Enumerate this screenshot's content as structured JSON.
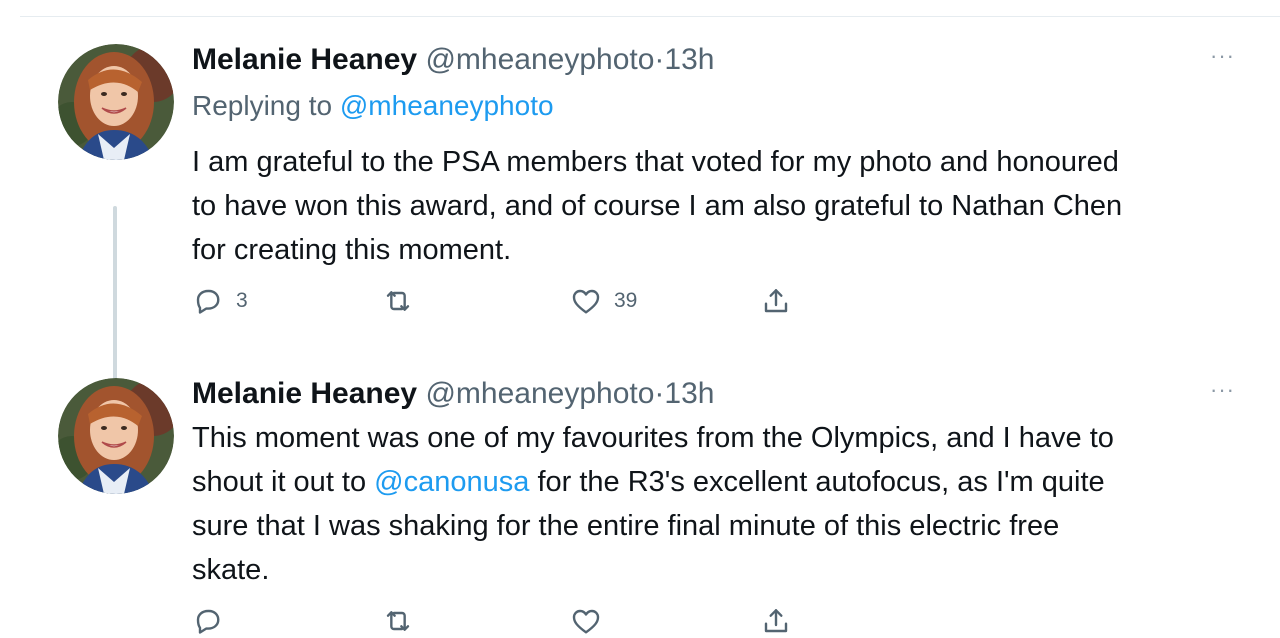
{
  "tweets": [
    {
      "author": "Melanie Heaney",
      "handle": "@mheaneyphoto",
      "separator": "·",
      "time": "13h",
      "replying_prefix": "Replying to ",
      "replying_to": "@mheaneyphoto",
      "more_label": "···",
      "text_lines": [
        "I am grateful to the PSA members that voted for my photo and honoured",
        "to have won this award, and of course I am also grateful to Nathan Chen",
        "for creating this moment."
      ],
      "reply_count": "3",
      "retweet_count": "",
      "like_count": "39"
    },
    {
      "author": "Melanie Heaney",
      "handle": "@mheaneyphoto",
      "separator": "·",
      "time": "13h",
      "more_label": "···",
      "text_line1": "This moment was one of my favourites from the Olympics, and I have to",
      "text_line2_before": "shout it out to ",
      "text_line2_mention": "@canonusa",
      "text_line2_after": " for the R3's excellent autofocus, as I'm quite",
      "text_line3": "sure that I was shaking for the entire final minute of this electric free",
      "text_line4": "skate."
    }
  ],
  "icons": [
    "reply-icon",
    "retweet-icon",
    "like-icon",
    "share-icon",
    "more-icon"
  ],
  "colors": {
    "link": "#1d9bf0",
    "muted": "#536471",
    "text": "#0f1419",
    "thread_line": "#cfd9de"
  }
}
